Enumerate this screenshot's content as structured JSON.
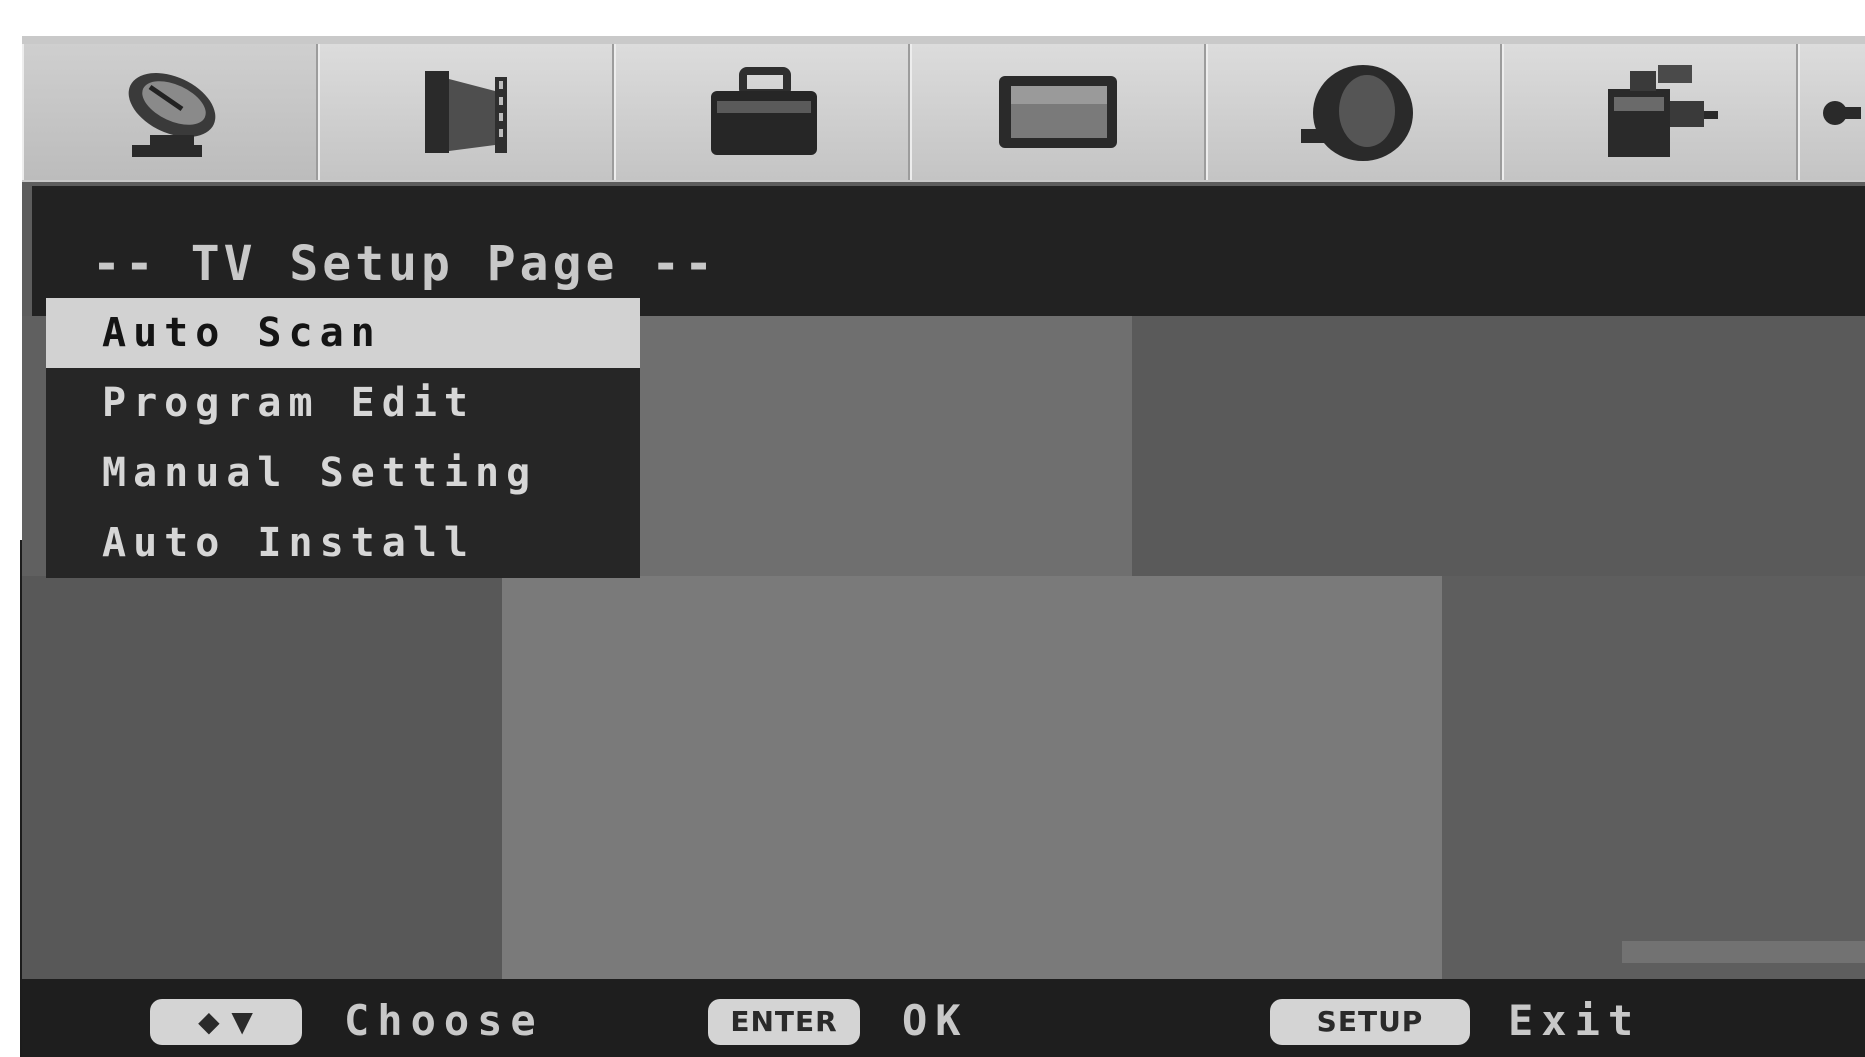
{
  "screen": {
    "page_title": "-- TV Setup Page --"
  },
  "tabs": [
    {
      "icon": "satellite-dish-icon",
      "active": true
    },
    {
      "icon": "film-reel-icon",
      "active": false
    },
    {
      "icon": "briefcase-icon",
      "active": false
    },
    {
      "icon": "tv-screen-icon",
      "active": false
    },
    {
      "icon": "speaker-icon",
      "active": false
    },
    {
      "icon": "projector-icon",
      "active": false
    },
    {
      "icon": "partial-icon",
      "active": false
    }
  ],
  "menu": {
    "items": [
      {
        "label": "Auto Scan",
        "selected": true
      },
      {
        "label": "Program Edit",
        "selected": false
      },
      {
        "label": "Manual Setting",
        "selected": false
      },
      {
        "label": "Auto Install",
        "selected": false
      }
    ]
  },
  "hints": {
    "choose_key": "◆ ▼",
    "choose_label": "Choose",
    "enter_key": "ENTER",
    "enter_label": "OK",
    "setup_key": "SETUP",
    "setup_label": "Exit"
  },
  "colors": {
    "selected_bg": "#d2d2d2",
    "menu_bg": "#262626",
    "screen_bg": "#5d5d5d"
  }
}
